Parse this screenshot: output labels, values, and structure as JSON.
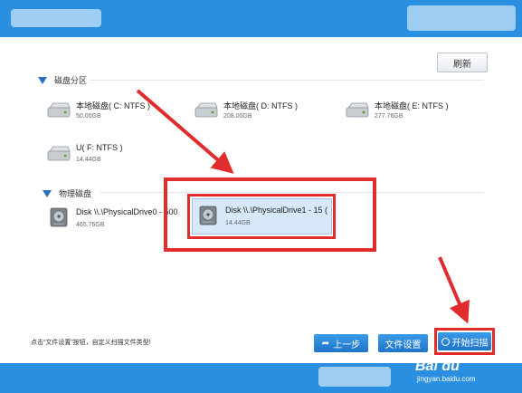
{
  "toolbar": {
    "refresh_label": "刷新"
  },
  "partitions": {
    "header": "磁盘分区",
    "items": [
      {
        "name": "本地磁盘( C: NTFS )",
        "size": "50.00GB"
      },
      {
        "name": "本地磁盘( D: NTFS )",
        "size": "208.00GB"
      },
      {
        "name": "本地磁盘( E: NTFS )",
        "size": "277.76GB"
      },
      {
        "name": "U( F: NTFS )",
        "size": "14.44GB"
      }
    ]
  },
  "physical": {
    "header": "物理磁盘",
    "items": [
      {
        "name": "Disk \\\\.\\PhysicalDrive0 - 500",
        "size": "465.76GB"
      },
      {
        "name": "Disk \\\\.\\PhysicalDrive1 - 15 (",
        "size": "14.44GB"
      }
    ]
  },
  "footer": {
    "hint": "点击“文件设置”按钮，自定义扫描文件类型!",
    "back_label": "上一步",
    "settings_label": "文件设置",
    "start_label": "开始扫描"
  },
  "watermark": {
    "logo": "Bai du",
    "site": "jingyan.baidu.com"
  },
  "colors": {
    "titlebar": "#2a8fe0",
    "highlight": "#e02c2c",
    "button": "#2a88da"
  }
}
